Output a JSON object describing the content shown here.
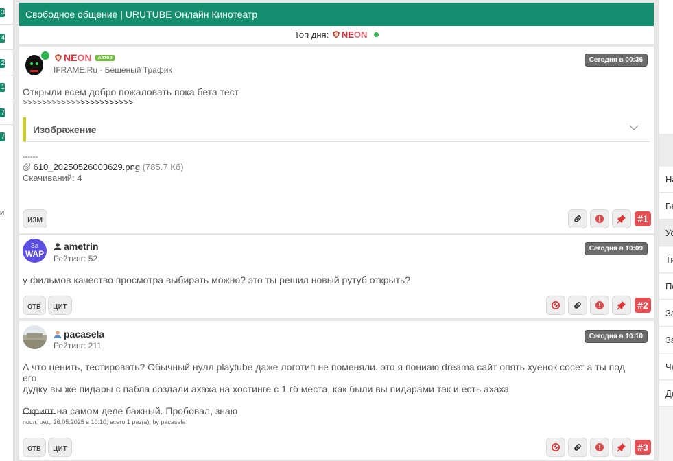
{
  "left_badges": [
    "3",
    "4",
    "2",
    "1",
    "7",
    "7"
  ],
  "left_char": "и",
  "right_nav": [
    {
      "label": "На",
      "active": false
    },
    {
      "label": "Бы",
      "active": false
    },
    {
      "label": "Ус",
      "active": true
    },
    {
      "label": "Ти",
      "active": false
    },
    {
      "label": "По",
      "active": false
    },
    {
      "label": "За",
      "active": false
    },
    {
      "label": "За",
      "active": false
    },
    {
      "label": "Че",
      "active": false
    },
    {
      "label": "До",
      "active": false
    }
  ],
  "header": {
    "title": "Свободное общение | URUTUBE Онлайн Кинотеатр"
  },
  "top_day": {
    "label": "Топ дня:",
    "nick_a": "NE",
    "nick_b": "ON"
  },
  "posts": [
    {
      "author_a": "NE",
      "author_b": "ON",
      "author_badge": "Автор",
      "subtitle": "IFRAME.Ru - Бешеный Трафик",
      "time": "Сегодня в 00:36",
      "text1": "Открыли всем добро пожаловать пока бета тест",
      "text2a": ">>>>>>>>>>>>",
      "text2b": ">>>>>>>>>>>",
      "spoiler_title": "Изображение",
      "dashes": "------",
      "file_name": "610_20250526003629.png",
      "file_size": "(785.7 Кб)",
      "downloads": "Скачиваний: 4",
      "button_edit": "изм",
      "number": "#1"
    },
    {
      "avatar_line1": "За",
      "avatar_line2": "WAP",
      "author": "ametrin",
      "rating": "Рейтинг: 52",
      "time": "Сегодня в 10:09",
      "text": "у фильмов качество просмотра выбирать можно? это ты решил новый рутуб открыть?",
      "button_reply": "отв",
      "button_quote": "цит",
      "number": "#2"
    },
    {
      "author": "pacasela",
      "rating": "Рейтинг: 211",
      "time": "Сегодня в 10:10",
      "text1": "А что ценить, тестировать? Обычный нулл playtube даже логотип не поменяли. это я пониаю dreama сайт опять хуенок сосет а ты под его",
      "text2": "дудку вы же пидары с пабла создали ахаха на хостинге с 1 гб места, как были вы пидарами так и есть ахаха",
      "text3": "Скрипт на самом деле бажный. Пробовал, знаю",
      "edit_note": "посл. ред. 26.05.2025 в 10:10; всего 1 раз(а); by pacasela",
      "button_reply": "отв",
      "button_quote": "цит",
      "number": "#3"
    }
  ],
  "colors": {
    "header_bg": "#158e6f",
    "number_badge": "#e44f54",
    "time_badge": "#6c6c6c",
    "author_badge": "#6fbf3b",
    "online": "#2bb24c"
  }
}
